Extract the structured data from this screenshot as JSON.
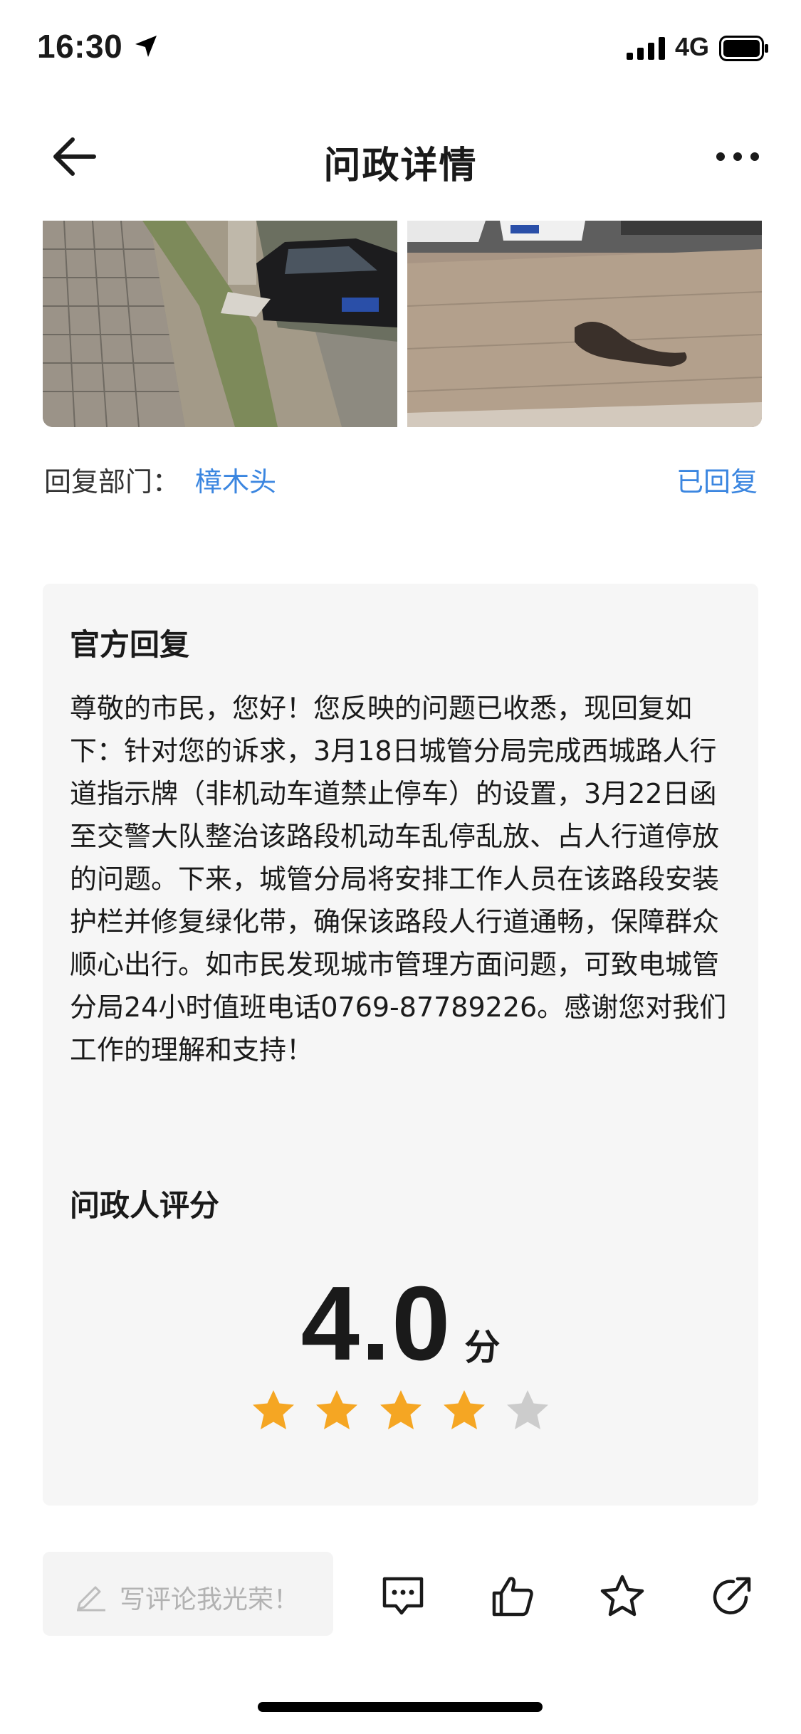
{
  "status_bar": {
    "time": "16:30",
    "network": "4G"
  },
  "nav": {
    "title": "问政详情"
  },
  "dept": {
    "label": "回复部门：",
    "value": "樟木头",
    "status": "已回复"
  },
  "official_reply": {
    "heading": "官方回复",
    "body": "尊敬的市民，您好！您反映的问题已收悉，现回复如下：针对您的诉求，3月18日城管分局完成西城路人行道指示牌（非机动车道禁止停车）的设置，3月22日函至交警大队整治该路段机动车乱停乱放、占人行道停放的问题。下来，城管分局将安排工作人员在该路段安装护栏并修复绿化带，确保该路段人行道通畅，保障群众顺心出行。如市民发现城市管理方面问题，可致电城管分局24小时值班电话0769-87789226。感谢您对我们工作的理解和支持！"
  },
  "rating": {
    "heading": "问政人评分",
    "score": "4.0",
    "unit": "分",
    "stars_filled": 4,
    "stars_total": 5
  },
  "bottom_bar": {
    "comment_placeholder": "写评论我光荣！"
  },
  "colors": {
    "accent": "#3b86e0",
    "star_filled": "#f5a623",
    "star_empty": "#cccccc"
  }
}
